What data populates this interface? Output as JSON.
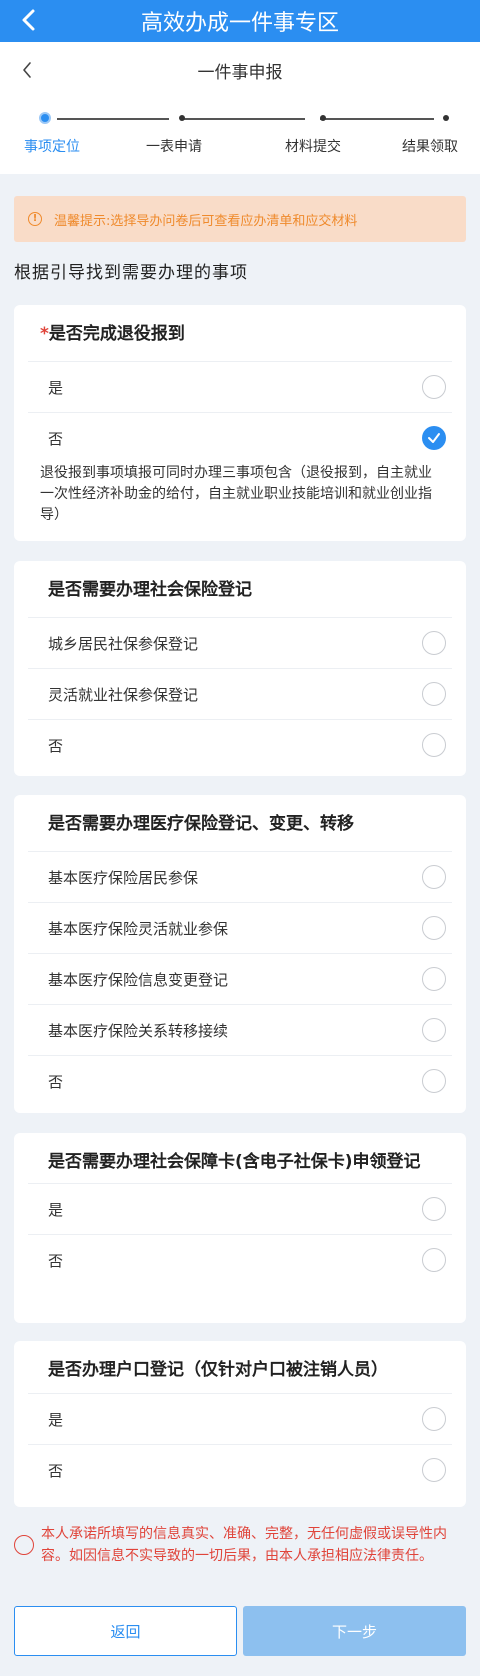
{
  "header": {
    "title": "高效办成一件事专区"
  },
  "subheader": {
    "title": "一件事申报"
  },
  "steps": [
    "事项定位",
    "一表申请",
    "材料提交",
    "结果领取"
  ],
  "notice": {
    "text": "温馨提示:选择导办问卷后可查看应办清单和应交材料"
  },
  "guide_text": "根据引导找到需要办理的事项",
  "questions": [
    {
      "required_mark": "*",
      "title": "是否完成退役报到",
      "options": [
        {
          "label": "是",
          "selected": false
        },
        {
          "label": "否",
          "selected": true
        }
      ],
      "note": "退役报到事项填报可同时办理三事项包含（退役报到，自主就业一次性经济补助金的给付，自主就业职业技能培训和就业创业指导）"
    },
    {
      "title": "是否需要办理社会保险登记",
      "options": [
        {
          "label": "城乡居民社保参保登记",
          "selected": false
        },
        {
          "label": "灵活就业社保参保登记",
          "selected": false
        },
        {
          "label": "否",
          "selected": false
        }
      ]
    },
    {
      "title": "是否需要办理医疗保险登记、变更、转移",
      "options": [
        {
          "label": "基本医疗保险居民参保",
          "selected": false
        },
        {
          "label": "基本医疗保险灵活就业参保",
          "selected": false
        },
        {
          "label": "基本医疗保险信息变更登记",
          "selected": false
        },
        {
          "label": "基本医疗保险关系转移接续",
          "selected": false
        },
        {
          "label": "否",
          "selected": false
        }
      ]
    },
    {
      "title": "是否需要办理社会保障卡(含电子社保卡)申领登记",
      "options": [
        {
          "label": "是",
          "selected": false
        },
        {
          "label": "否",
          "selected": false
        }
      ]
    },
    {
      "title": "是否办理户口登记（仅针对户口被注销人员）",
      "options": [
        {
          "label": "是",
          "selected": false
        },
        {
          "label": "否",
          "selected": false
        }
      ]
    }
  ],
  "consent": {
    "text": "本人承诺所填写的信息真实、准确、完整，无任何虚假或误导性内容。如因信息不实导致的一切后果，由本人承担相应法律责任。"
  },
  "buttons": {
    "back": "返回",
    "next": "下一步"
  },
  "colors": {
    "primary": "#2b8ef1",
    "warning": "#ef8a2c",
    "danger": "#e0443a",
    "disabled": "#8dc0ef"
  }
}
